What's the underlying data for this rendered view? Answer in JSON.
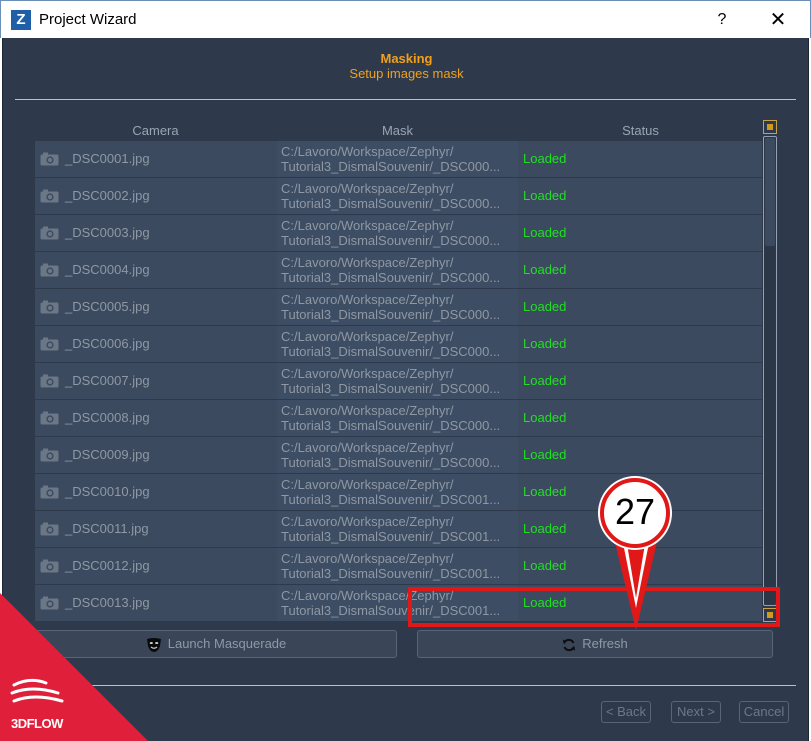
{
  "window": {
    "logo_letter": "Z",
    "title": "Project Wizard",
    "help_label": "?",
    "close_label": "✕"
  },
  "header": {
    "title": "Masking",
    "subtitle": "Setup images mask"
  },
  "table": {
    "columns": [
      "Camera",
      "Mask",
      "Status"
    ],
    "rows": [
      {
        "camera": "_DSC0001.jpg",
        "mask_line1": "C:/Lavoro/Workspace/Zephyr/",
        "mask_line2": "Tutorial3_DismalSouvenir/_DSC000...",
        "status": "Loaded"
      },
      {
        "camera": "_DSC0002.jpg",
        "mask_line1": "C:/Lavoro/Workspace/Zephyr/",
        "mask_line2": "Tutorial3_DismalSouvenir/_DSC000...",
        "status": "Loaded"
      },
      {
        "camera": "_DSC0003.jpg",
        "mask_line1": "C:/Lavoro/Workspace/Zephyr/",
        "mask_line2": "Tutorial3_DismalSouvenir/_DSC000...",
        "status": "Loaded"
      },
      {
        "camera": "_DSC0004.jpg",
        "mask_line1": "C:/Lavoro/Workspace/Zephyr/",
        "mask_line2": "Tutorial3_DismalSouvenir/_DSC000...",
        "status": "Loaded"
      },
      {
        "camera": "_DSC0005.jpg",
        "mask_line1": "C:/Lavoro/Workspace/Zephyr/",
        "mask_line2": "Tutorial3_DismalSouvenir/_DSC000...",
        "status": "Loaded"
      },
      {
        "camera": "_DSC0006.jpg",
        "mask_line1": "C:/Lavoro/Workspace/Zephyr/",
        "mask_line2": "Tutorial3_DismalSouvenir/_DSC000...",
        "status": "Loaded"
      },
      {
        "camera": "_DSC0007.jpg",
        "mask_line1": "C:/Lavoro/Workspace/Zephyr/",
        "mask_line2": "Tutorial3_DismalSouvenir/_DSC000...",
        "status": "Loaded"
      },
      {
        "camera": "_DSC0008.jpg",
        "mask_line1": "C:/Lavoro/Workspace/Zephyr/",
        "mask_line2": "Tutorial3_DismalSouvenir/_DSC000...",
        "status": "Loaded"
      },
      {
        "camera": "_DSC0009.jpg",
        "mask_line1": "C:/Lavoro/Workspace/Zephyr/",
        "mask_line2": "Tutorial3_DismalSouvenir/_DSC000...",
        "status": "Loaded"
      },
      {
        "camera": "_DSC0010.jpg",
        "mask_line1": "C:/Lavoro/Workspace/Zephyr/",
        "mask_line2": "Tutorial3_DismalSouvenir/_DSC001...",
        "status": "Loaded"
      },
      {
        "camera": "_DSC0011.jpg",
        "mask_line1": "C:/Lavoro/Workspace/Zephyr/",
        "mask_line2": "Tutorial3_DismalSouvenir/_DSC001...",
        "status": "Loaded"
      },
      {
        "camera": "_DSC0012.jpg",
        "mask_line1": "C:/Lavoro/Workspace/Zephyr/",
        "mask_line2": "Tutorial3_DismalSouvenir/_DSC001...",
        "status": "Loaded"
      },
      {
        "camera": "_DSC0013.jpg",
        "mask_line1": "C:/Lavoro/Workspace/Zephyr/",
        "mask_line2": "Tutorial3_DismalSouvenir/_DSC001...",
        "status": "Loaded"
      }
    ]
  },
  "actions": {
    "launch_label": "Launch Masquerade",
    "launch_icon": "theater-mask-icon",
    "refresh_label": "Refresh",
    "refresh_icon": "refresh-icon"
  },
  "nav": {
    "back_label": "< Back",
    "next_label": "Next >",
    "cancel_label": "Cancel"
  },
  "annotation": {
    "step_number": "27"
  },
  "brand": {
    "corner_text": "3DFLOW"
  },
  "colors": {
    "accent": "#f0a01a",
    "status_ok": "#21e021",
    "highlight": "#e01818",
    "background": "#2e3a4b"
  }
}
